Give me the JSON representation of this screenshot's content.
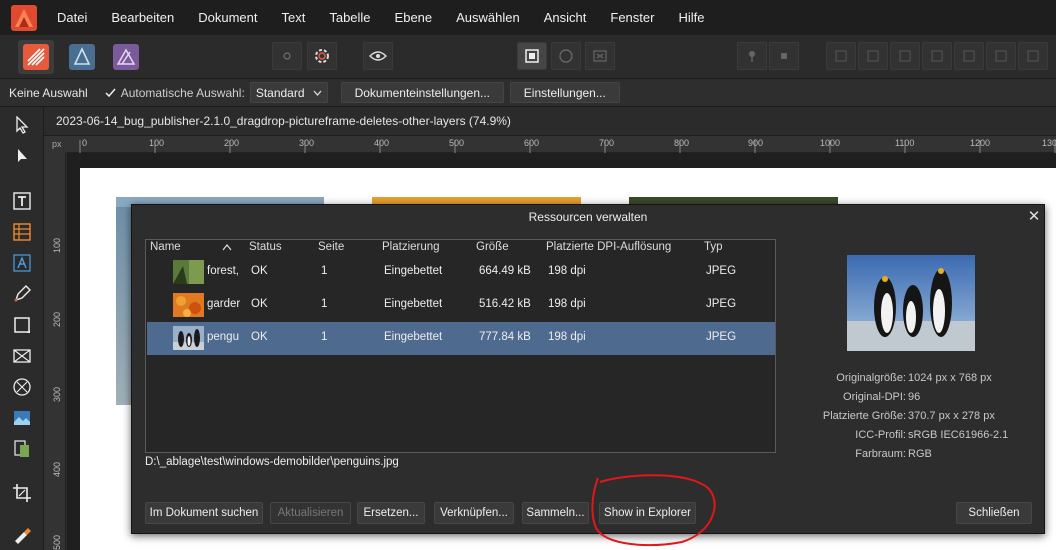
{
  "menu": [
    "Datei",
    "Bearbeiten",
    "Dokument",
    "Text",
    "Tabelle",
    "Ebene",
    "Auswählen",
    "Ansicht",
    "Fenster",
    "Hilfe"
  ],
  "context_bar": {
    "selection": "Keine Auswahl",
    "auto_select_label": "Automatische Auswahl:",
    "auto_select_value": "Standard",
    "doc_settings": "Dokumenteinstellungen...",
    "settings": "Einstellungen..."
  },
  "document_title": "2023-06-14_bug_publisher-2.1.0_dragdrop-pictureframe-deletes-other-layers (74.9%)",
  "ruler": {
    "unit": "px",
    "h_labels": [
      "0",
      "100",
      "200",
      "300",
      "400",
      "500",
      "600",
      "700",
      "800",
      "900",
      "1000",
      "1100",
      "1200",
      "130"
    ],
    "v_labels": [
      "100",
      "200",
      "300",
      "400",
      "500"
    ]
  },
  "dialog": {
    "title": "Ressourcen verwalten",
    "columns": [
      "Name",
      "Status",
      "Seite",
      "Platzierung",
      "Größe",
      "Platzierte DPI-Auflösung",
      "Typ"
    ],
    "rows": [
      {
        "name": "forest,",
        "status": "OK",
        "page": "1",
        "placement": "Eingebettet",
        "size": "664.49 kB",
        "dpi": "198 dpi",
        "type": "JPEG"
      },
      {
        "name": "garder",
        "status": "OK",
        "page": "1",
        "placement": "Eingebettet",
        "size": "516.42 kB",
        "dpi": "198 dpi",
        "type": "JPEG"
      },
      {
        "name": "pengu",
        "status": "OK",
        "page": "1",
        "placement": "Eingebettet",
        "size": "777.84 kB",
        "dpi": "198 dpi",
        "type": "JPEG"
      }
    ],
    "selected_row": 2,
    "path": "D:\\_ablage\\test\\windows-demobilder\\penguins.jpg",
    "info": [
      {
        "label": "Originalgröße:",
        "value": "1024 px x 768 px"
      },
      {
        "label": "Original-DPI:",
        "value": "96"
      },
      {
        "label": "Platzierte Größe:",
        "value": "370.7 px x 278 px"
      },
      {
        "label": "ICC-Profil:",
        "value": "sRGB IEC61966-2.1"
      },
      {
        "label": "Farbraum:",
        "value": "RGB"
      }
    ],
    "buttons": {
      "find": "Im Dokument suchen",
      "update": "Aktualisieren",
      "replace": "Ersetzen...",
      "link": "Verknüpfen...",
      "collect": "Sammeln...",
      "explorer": "Show in Explorer",
      "close": "Schließen"
    }
  },
  "colors": {
    "accent": "#e0503a",
    "selection": "#4e6a8e",
    "annotation": "#e01818"
  }
}
